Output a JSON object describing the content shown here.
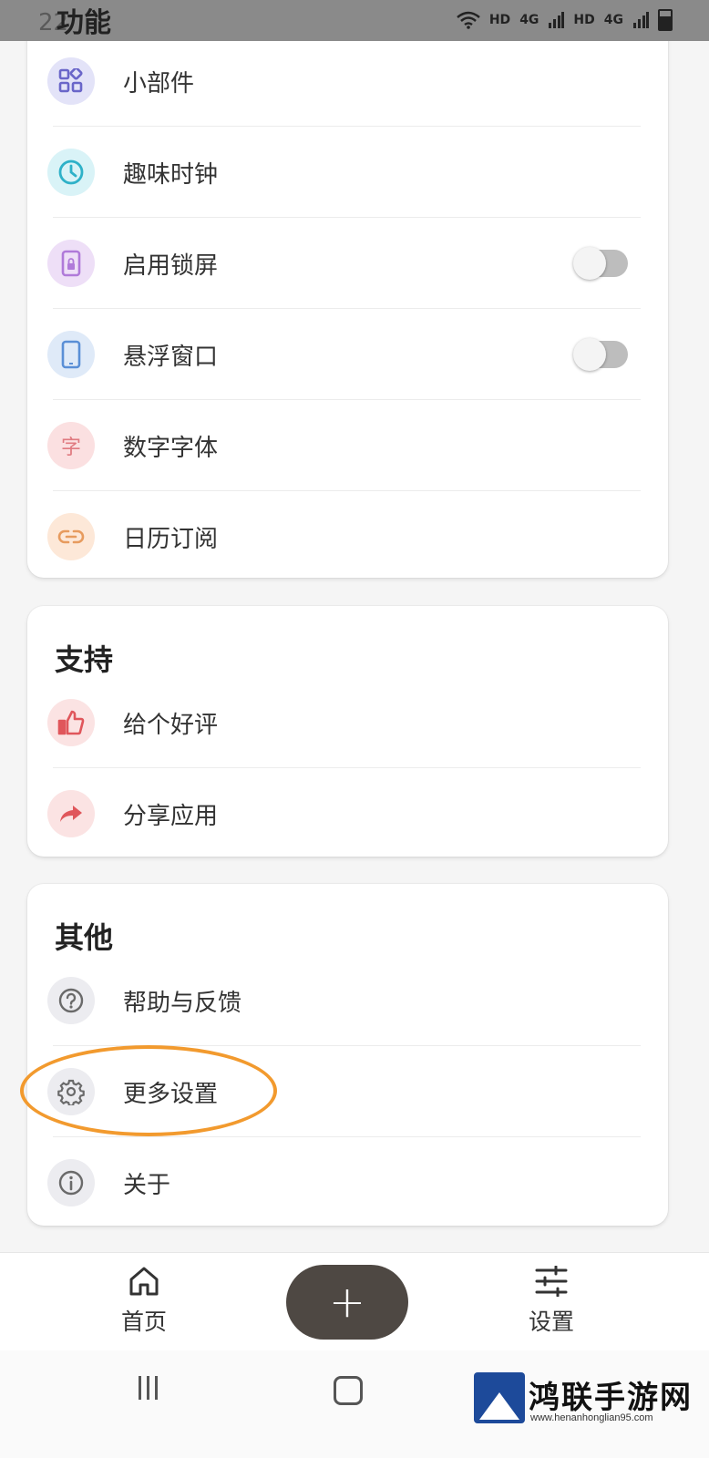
{
  "status_bar": {
    "time": "22",
    "net_labels": [
      "HD",
      "4G",
      "HD",
      "4G"
    ]
  },
  "sections": {
    "features": {
      "title": "功能",
      "items": [
        {
          "label": "小部件",
          "icon": "widgets-icon",
          "icon_bg": "#e3e3f8",
          "icon_color": "#6a66c9"
        },
        {
          "label": "趣味时钟",
          "icon": "clock-icon",
          "icon_bg": "#d9f3f7",
          "icon_color": "#2eb1c8"
        },
        {
          "label": "启用锁屏",
          "icon": "lock-screen-icon",
          "icon_bg": "#eedff7",
          "icon_color": "#b07ad9",
          "toggle": false
        },
        {
          "label": "悬浮窗口",
          "icon": "phone-icon",
          "icon_bg": "#dfeaf8",
          "icon_color": "#5a8fd6",
          "toggle": false
        },
        {
          "label": "数字字体",
          "icon": "character-icon",
          "icon_bg": "#fbe0e1",
          "icon_color": "#e07a80",
          "glyph": "字"
        },
        {
          "label": "日历订阅",
          "icon": "link-icon",
          "icon_bg": "#fde8d8",
          "icon_color": "#e79b5e"
        }
      ]
    },
    "support": {
      "title": "支持",
      "items": [
        {
          "label": "给个好评",
          "icon": "thumbs-up-icon",
          "icon_bg": "#fbe3e3",
          "icon_color": "#e0565b"
        },
        {
          "label": "分享应用",
          "icon": "share-icon",
          "icon_bg": "#fbe3e3",
          "icon_color": "#e0565b"
        }
      ]
    },
    "other": {
      "title": "其他",
      "items": [
        {
          "label": "帮助与反馈",
          "icon": "help-icon",
          "icon_bg": "#ececf0",
          "icon_color": "#6a6a6a"
        },
        {
          "label": "更多设置",
          "icon": "gear-icon",
          "icon_bg": "#ececf0",
          "icon_color": "#6a6a6a"
        },
        {
          "label": "关于",
          "icon": "info-icon",
          "icon_bg": "#ececf0",
          "icon_color": "#6a6a6a"
        }
      ]
    }
  },
  "bottom_nav": {
    "home_label": "首页",
    "settings_label": "设置",
    "add_label": "+"
  },
  "watermark": {
    "name": "鸿联手游网",
    "url": "www.henanhonglian95.com"
  },
  "colors": {
    "highlight": "#f29a2e",
    "fab": "#4e4843",
    "watermark_logo": "#1d4a9a"
  }
}
